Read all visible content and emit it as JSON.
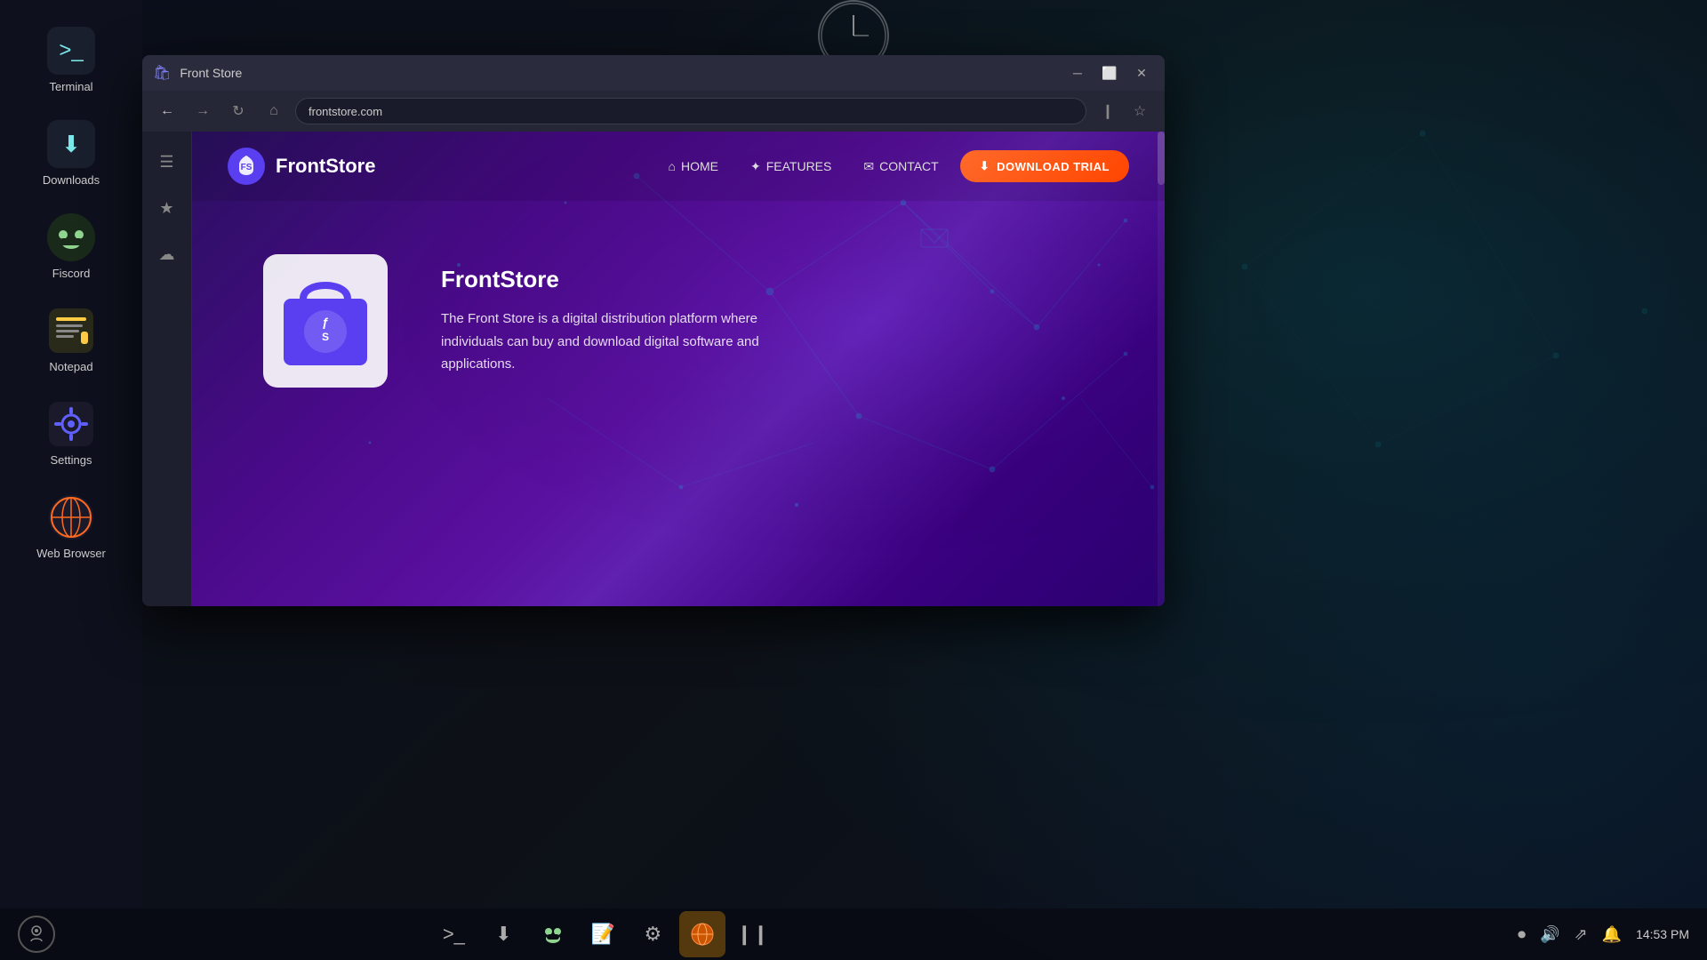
{
  "desktop": {
    "background_color": "#0d1117"
  },
  "sidebar": {
    "apps": [
      {
        "id": "terminal",
        "label": "Terminal",
        "icon": ">_"
      },
      {
        "id": "downloads",
        "label": "Downloads",
        "icon": "⬇"
      },
      {
        "id": "fiscord",
        "label": "Fiscord",
        "icon": "😀"
      },
      {
        "id": "notepad",
        "label": "Notepad",
        "icon": "📝"
      },
      {
        "id": "settings",
        "label": "Settings",
        "icon": "⚙"
      },
      {
        "id": "webbrowser",
        "label": "Web Browser",
        "icon": "🌐"
      }
    ]
  },
  "browser": {
    "title": "Front Store",
    "url": "frontstore.com",
    "sidebar_icons": [
      "☰",
      "★",
      "☁"
    ]
  },
  "website": {
    "logo_text": "FrontStore",
    "nav": {
      "home": "HOME",
      "features": "FEATURES",
      "contact": "CONTACT",
      "cta_button": "DOWNLOAD TRIAL"
    },
    "hero": {
      "title": "FrontStore",
      "description": "The Front Store is a digital distribution platform where individuals can buy and download digital software and applications."
    }
  },
  "taskbar": {
    "apps": [
      {
        "id": "terminal",
        "icon": ">_",
        "active": false
      },
      {
        "id": "downloads",
        "icon": "⬇",
        "active": false
      },
      {
        "id": "fiscord",
        "icon": "😀",
        "active": false
      },
      {
        "id": "notepad",
        "icon": "📝",
        "active": false
      },
      {
        "id": "settings",
        "icon": "⚙",
        "active": false
      },
      {
        "id": "webbrowser",
        "icon": "🌐",
        "active": true
      },
      {
        "id": "split",
        "icon": "❙❙",
        "active": false
      }
    ],
    "system": {
      "time": "14:53 PM",
      "icons": [
        "⏺",
        "🔊",
        "⇗",
        "🔔"
      ]
    }
  }
}
